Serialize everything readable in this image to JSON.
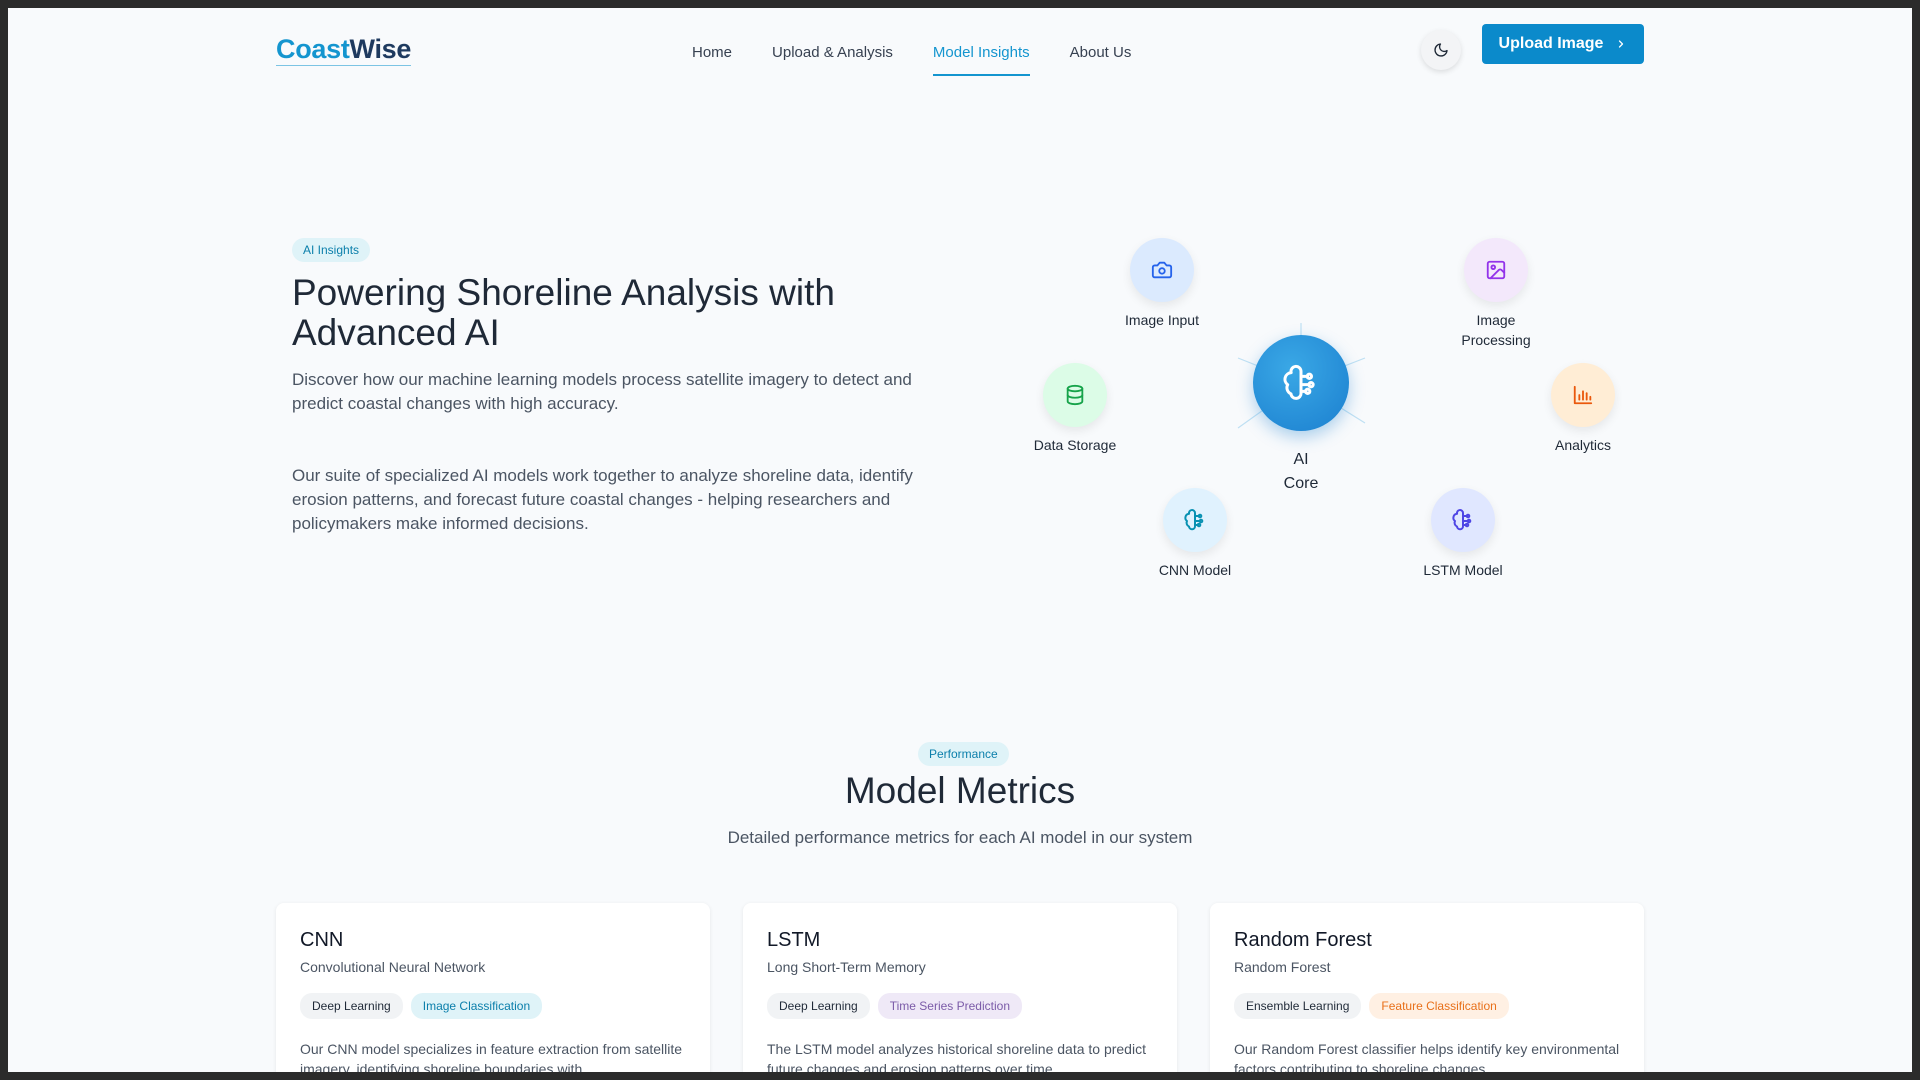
{
  "nav": {
    "logo_part1": "Coast",
    "logo_part2": "Wise",
    "links": [
      {
        "label": "Home"
      },
      {
        "label": "Upload & Analysis"
      },
      {
        "label": "Model Insights",
        "active": true
      },
      {
        "label": "About Us"
      }
    ],
    "upload_button": "Upload Image",
    "theme_icon": "moon-icon"
  },
  "hero": {
    "badge": "AI Insights",
    "title": "Powering Shoreline Analysis with Advanced AI",
    "description": "Discover how our machine learning models process satellite imagery to detect and predict coastal changes with high accuracy.",
    "description2": "Our suite of specialized AI models work together to analyze shoreline data, identify erosion patterns, and forecast future coastal changes - helping researchers and policymakers make informed decisions."
  },
  "diagram": {
    "core_label": "AI Core",
    "nodes": [
      {
        "label": "Image Input",
        "icon": "camera-icon"
      },
      {
        "label": "Image Processing",
        "icon": "image-icon"
      },
      {
        "label": "Data Storage",
        "icon": "database-icon"
      },
      {
        "label": "Analytics",
        "icon": "bar-chart-icon"
      },
      {
        "label": "CNN Model",
        "icon": "brain-icon"
      },
      {
        "label": "LSTM Model",
        "icon": "brain-icon"
      }
    ]
  },
  "metrics": {
    "badge": "Performance",
    "title": "Model Metrics",
    "subtitle": "Detailed performance metrics for each AI model in our system",
    "cards": [
      {
        "title": "CNN",
        "subtitle": "Convolutional Neural Network",
        "tags": [
          "Deep Learning",
          "Image Classification"
        ],
        "description": "Our CNN model specializes in feature extraction from satellite imagery, identifying shoreline boundaries with"
      },
      {
        "title": "LSTM",
        "subtitle": "Long Short-Term Memory",
        "tags": [
          "Deep Learning",
          "Time Series Prediction"
        ],
        "description": "The LSTM model analyzes historical shoreline data to predict future changes and erosion patterns over time"
      },
      {
        "title": "Random Forest",
        "subtitle": "Random Forest",
        "tags": [
          "Ensemble Learning",
          "Feature Classification"
        ],
        "description": "Our Random Forest classifier helps identify key environmental factors contributing to shoreline changes"
      }
    ]
  }
}
